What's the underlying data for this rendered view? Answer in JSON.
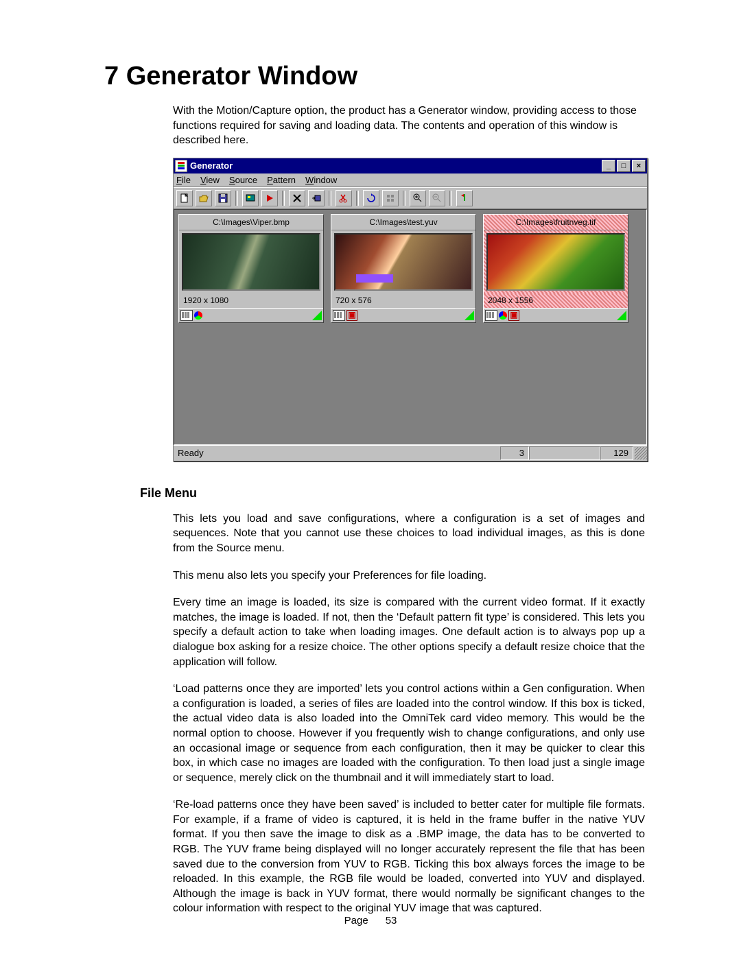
{
  "heading": "7 Generator Window",
  "intro": "With the Motion/Capture option, the product has a Generator window, providing access to those functions required for saving and loading data.  The contents and operation of this window is described here.",
  "file_menu": {
    "heading": "File Menu",
    "paragraphs": [
      "This lets you load and save configurations, where a configuration is a set of images and sequences.  Note that you cannot use these choices to load individual images, as this is done from the Source menu.",
      "This menu also lets you specify your Preferences for file loading.",
      "Every time an image is loaded, its size is compared with the current video format.  If it exactly matches, the image is loaded.  If not, then the ‘Default pattern fit type’ is considered.  This lets you specify a default action to take when loading images.  One default action is to always pop up a dialogue box asking for a resize choice.  The other options specify a default resize choice that the application will follow.",
      "‘Load patterns once they are imported’ lets you control actions within a Gen configuration.  When a configuration is loaded, a series of files are loaded into the control window.  If this box is ticked, the actual video data is also loaded into the OmniTek card video memory.  This would be the normal option to choose.  However if you frequently wish to change configurations, and only use an occasional image or sequence from each configuration, then it may be quicker to clear this box, in which case no images are loaded with the configuration.  To then load just a single image or sequence, merely click on the thumbnail and it will immediately start to load.",
      "‘Re-load patterns once they have been saved’ is included to better cater for multiple file formats.  For example, if a frame of video is captured, it is held in the frame buffer in the native YUV format.  If you then save the image to disk as a .BMP image, the data has to be converted to RGB.  The YUV frame being displayed will no longer accurately represent the file that has been saved due to the conversion from YUV to RGB.  Ticking this box always forces the image to be reloaded.  In this example, the RGB file would be loaded, converted into YUV and displayed.  Although the image is back in YUV format, there would normally be significant changes to the colour information with respect to the original YUV image that was captured."
    ]
  },
  "footer": {
    "label": "Page",
    "num": "53"
  },
  "window": {
    "title": "Generator",
    "menus": {
      "file": "File",
      "view": "View",
      "source": "Source",
      "pattern": "Pattern",
      "window": "Window"
    },
    "status": {
      "ready": "Ready",
      "val1": "3",
      "val2": "129"
    },
    "cards": [
      {
        "path": "C:\\Images\\Viper.bmp",
        "dim": "1920 x 1080",
        "selected": false
      },
      {
        "path": "C:\\Images\\test.yuv",
        "dim": "720 x 576",
        "selected": false
      },
      {
        "path": "C:\\Images\\fruitnveg.tif",
        "dim": "2048 x 1556",
        "selected": true
      }
    ]
  }
}
